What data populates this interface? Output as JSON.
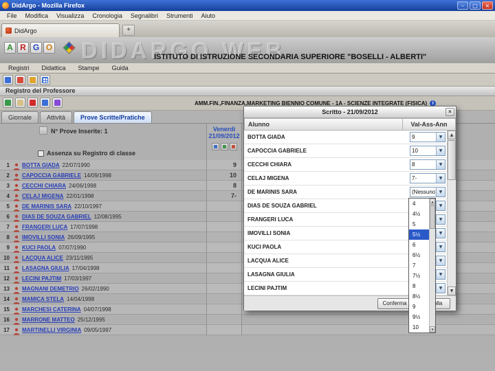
{
  "window": {
    "title": "DidArgo - Mozilla Firefox"
  },
  "icons": {
    "minimize": "–",
    "maximize": "□",
    "close": "×",
    "new_tab": "+",
    "dialog_close": "×",
    "select_arrow": "▼",
    "scroll_up": "▲",
    "scroll_down": "▼",
    "info": "i"
  },
  "browser_menu": {
    "items": [
      "File",
      "Modifica",
      "Visualizza",
      "Cronologia",
      "Segnalibri",
      "Strumenti",
      "Aiuto"
    ]
  },
  "tab": {
    "label": "DidArgo"
  },
  "banner": {
    "logo_letters": [
      "A",
      "R",
      "G",
      "O"
    ],
    "watermark": "DIDARGO WEB",
    "institute_title": "ISTITUTO DI ISTRUZIONE SECONDARIA SUPERIORE \"BOSELLI - ALBERTI\""
  },
  "app_menu": {
    "items": [
      "Registri",
      "Didattica",
      "Stampe",
      "Guida"
    ]
  },
  "section_title": "Registro del Professore",
  "class_banner": "AMM.FIN.,FINANZA,MARKETING BIENNIO COMUNE - 1A - SCIENZE INTEGRATE (FISICA)",
  "tabs": [
    {
      "label": "Giornale",
      "active": false
    },
    {
      "label": "Attività",
      "active": false
    },
    {
      "label": "Prove Scritte/Pratiche",
      "active": true
    }
  ],
  "prove_summary": "N° Prove Inserite: 1",
  "prova_column": {
    "day": "Venerdì",
    "date": "21/09/2012"
  },
  "absence_label": "Assenza su Registro di classe",
  "students": [
    {
      "n": "1",
      "name": "BOTTA GIADA",
      "birth": "22/07/1990",
      "grade": "9"
    },
    {
      "n": "2",
      "name": "CAPOCCIA GABRIELE",
      "birth": "14/09/1998",
      "grade": "10"
    },
    {
      "n": "3",
      "name": "CECCHI CHIARA",
      "birth": "24/06/1998",
      "grade": "8"
    },
    {
      "n": "4",
      "name": "CELAJ MIGENA",
      "birth": "22/01/1998",
      "grade": "7-"
    },
    {
      "n": "5",
      "name": "DE MARINIS SARA",
      "birth": "22/10/1997",
      "grade": ""
    },
    {
      "n": "6",
      "name": "DIAS DE SOUZA GABRIEL",
      "birth": "12/08/1995",
      "grade": ""
    },
    {
      "n": "7",
      "name": "FRANGERI LUCA",
      "birth": "17/07/1998",
      "grade": ""
    },
    {
      "n": "8",
      "name": "IMOVILLI SONIA",
      "birth": "26/09/1995",
      "grade": ""
    },
    {
      "n": "9",
      "name": "KUCI PAOLA",
      "birth": "07/07/1990",
      "grade": ""
    },
    {
      "n": "10",
      "name": "LACQUA ALICE",
      "birth": "23/11/1995",
      "grade": ""
    },
    {
      "n": "11",
      "name": "LASAGNA GIULIA",
      "birth": "17/04/1998",
      "grade": ""
    },
    {
      "n": "12",
      "name": "LECINI PAJTIM",
      "birth": "17/03/1997",
      "grade": ""
    },
    {
      "n": "13",
      "name": "MAGNANI DEMETRIO",
      "birth": "26/02/1990",
      "grade": ""
    },
    {
      "n": "14",
      "name": "MAMICA STELA",
      "birth": "14/04/1998",
      "grade": ""
    },
    {
      "n": "15",
      "name": "MARCHESI CATERINA",
      "birth": "04/07/1998",
      "grade": ""
    },
    {
      "n": "16",
      "name": "MARRONE MATTEO",
      "birth": "25/12/1995",
      "grade": ""
    },
    {
      "n": "17",
      "name": "MARTINELLI VIRGINIA",
      "birth": "09/05/1997",
      "grade": ""
    }
  ],
  "dialog": {
    "title": "Scritto - 21/09/2012",
    "columns": {
      "student": "Alunno",
      "value": "Val-Ass-Ann"
    },
    "rows": [
      {
        "name": "BOTTA GIADA",
        "value": "9"
      },
      {
        "name": "CAPOCCIA GABRIELE",
        "value": "10"
      },
      {
        "name": "CECCHI CHIARA",
        "value": "8"
      },
      {
        "name": "CELAJ MIGENA",
        "value": "7-"
      },
      {
        "name": "DE MARINIS SARA",
        "value": "(Nessuno)"
      },
      {
        "name": "DIAS DE SOUZA GABRIEL",
        "value": ""
      },
      {
        "name": "FRANGERI LUCA",
        "value": ""
      },
      {
        "name": "IMOVILLI SONIA",
        "value": ""
      },
      {
        "name": "KUCI PAOLA",
        "value": ""
      },
      {
        "name": "LACQUA ALICE",
        "value": ""
      },
      {
        "name": "LASAGNA GIULIA",
        "value": ""
      },
      {
        "name": "LECINI PAJTIM",
        "value": ""
      }
    ],
    "open_dropdown": {
      "for": "DE MARINIS SARA",
      "options": [
        "4",
        "4½",
        "5",
        "5½",
        "6",
        "6½",
        "7",
        "7½",
        "8",
        "8½",
        "9",
        "9½",
        "10"
      ],
      "highlighted": "5½"
    },
    "buttons": {
      "confirm": "Conferma",
      "cancel": "Annulla"
    }
  }
}
